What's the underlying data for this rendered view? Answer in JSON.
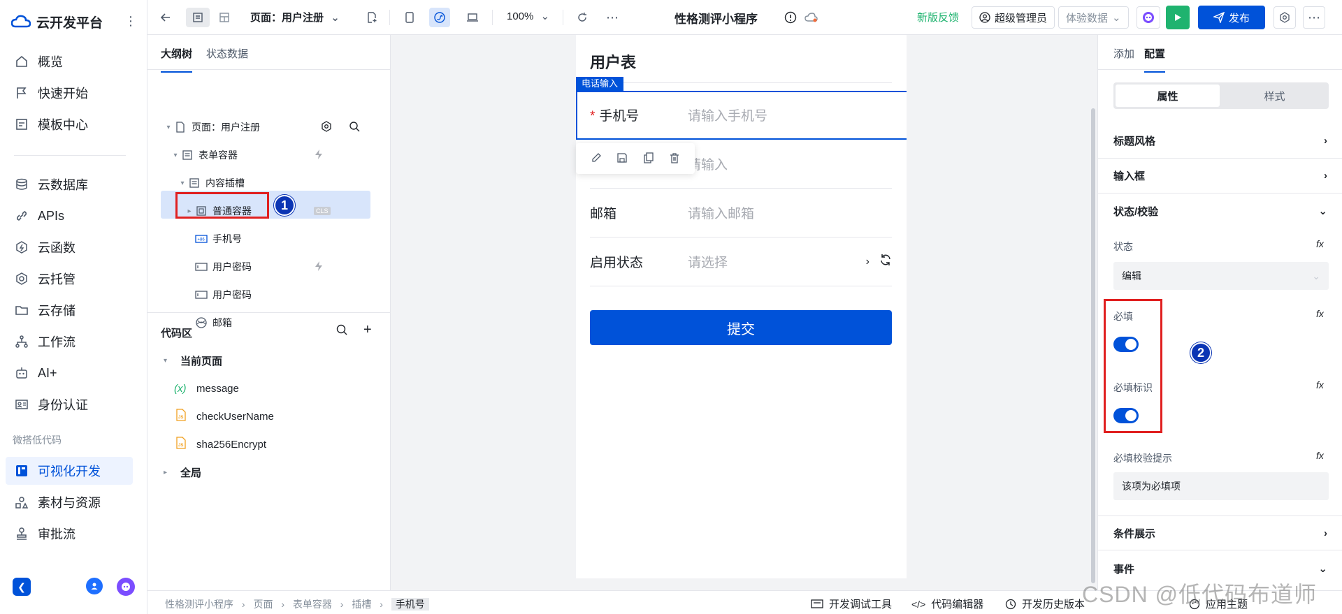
{
  "app": {
    "brand": "云开发平台"
  },
  "nav": {
    "items": [
      {
        "label": "概览",
        "icon": "home-icon"
      },
      {
        "label": "快速开始",
        "icon": "flag-icon"
      },
      {
        "label": "模板中心",
        "icon": "template-icon"
      },
      {
        "label": "云数据库",
        "icon": "database-icon"
      },
      {
        "label": "APIs",
        "icon": "link-icon"
      },
      {
        "label": "云函数",
        "icon": "function-icon"
      },
      {
        "label": "云托管",
        "icon": "hexagon-icon"
      },
      {
        "label": "云存储",
        "icon": "folder-icon"
      },
      {
        "label": "工作流",
        "icon": "workflow-icon"
      },
      {
        "label": "AI+",
        "icon": "robot-icon"
      },
      {
        "label": "身份认证",
        "icon": "id-card-icon"
      },
      {
        "label": "可视化开发",
        "icon": "visual-dev-icon"
      },
      {
        "label": "素材与资源",
        "icon": "assets-icon"
      },
      {
        "label": "审批流",
        "icon": "approval-icon"
      }
    ],
    "group_label": "微搭低代码"
  },
  "topbar": {
    "page_select": "页面：用户注册",
    "zoom": "100%",
    "app_title": "性格测评小程序",
    "feedback": "新版反馈",
    "user": "超级管理员",
    "data_mode": "体验数据",
    "publish": "发布"
  },
  "outline": {
    "tabs": [
      "大纲树",
      "状态数据"
    ],
    "tree": [
      {
        "label": "页面：用户注册"
      },
      {
        "label": "表单容器"
      },
      {
        "label": "内容插槽"
      },
      {
        "label": "普通容器",
        "tag": "CLS"
      },
      {
        "label": "手机号"
      },
      {
        "label": "用户密码"
      },
      {
        "label": "用户密码"
      },
      {
        "label": "邮箱"
      }
    ],
    "annotation_1": "1"
  },
  "code": {
    "title": "代码区",
    "current_page": "当前页面",
    "items": [
      {
        "label": "message",
        "prefix": "(x)"
      },
      {
        "label": "checkUserName",
        "prefix": "JS"
      },
      {
        "label": "sha256Encrypt",
        "prefix": "JS"
      }
    ],
    "global": "全局"
  },
  "canvas": {
    "form_title": "用户表",
    "selected_tag": "电话输入",
    "rows": [
      {
        "label": "手机号",
        "placeholder": "请输入手机号",
        "required": "*"
      },
      {
        "label": "",
        "placeholder": "请输入"
      },
      {
        "label": "邮箱",
        "placeholder": "请输入邮箱"
      },
      {
        "label": "启用状态",
        "placeholder": "请选择"
      }
    ],
    "submit": "提交"
  },
  "props": {
    "tabs": [
      "添加",
      "配置"
    ],
    "segments": [
      "属性",
      "样式"
    ],
    "sections": {
      "title_style": "标题风格",
      "input_box": "输入框",
      "status_check": "状态/校验",
      "conditional": "条件展示",
      "events": "事件"
    },
    "state_label": "状态",
    "state_value": "编辑",
    "required_label": "必填",
    "required_on": true,
    "required_mark_label": "必填标识",
    "required_mark_on": true,
    "required_hint_label": "必填校验提示",
    "required_hint_value": "该项为必填项",
    "fx": "fx",
    "annotation_2": "2"
  },
  "bottombar": {
    "breadcrumb": [
      "性格测评小程序",
      "页面",
      "表单容器",
      "插槽",
      "手机号"
    ],
    "tools": [
      "开发调试工具",
      "代码编辑器",
      "开发历史版本",
      "应用主题"
    ]
  },
  "watermark": "CSDN @低代码布道师",
  "colors": {
    "primary": "#0052d9",
    "annotation_red": "#e02020",
    "run_green": "#1fb36f"
  }
}
